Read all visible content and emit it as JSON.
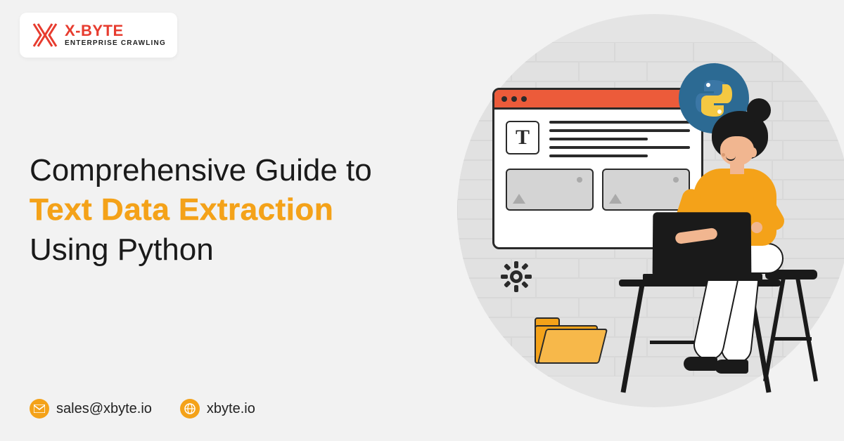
{
  "logo": {
    "brand": "X-BYTE",
    "tagline": "ENTERPRISE CRAWLING"
  },
  "headline": {
    "line1": "Comprehensive Guide to",
    "highlight": "Text Data Extraction",
    "line3": "Using Python"
  },
  "contact": {
    "email": "sales@xbyte.io",
    "website": "xbyte.io"
  },
  "colors": {
    "accent": "#f4a219",
    "brand_red": "#e73c2f",
    "python_blue": "#2c6a93",
    "python_yellow": "#f4c842"
  }
}
